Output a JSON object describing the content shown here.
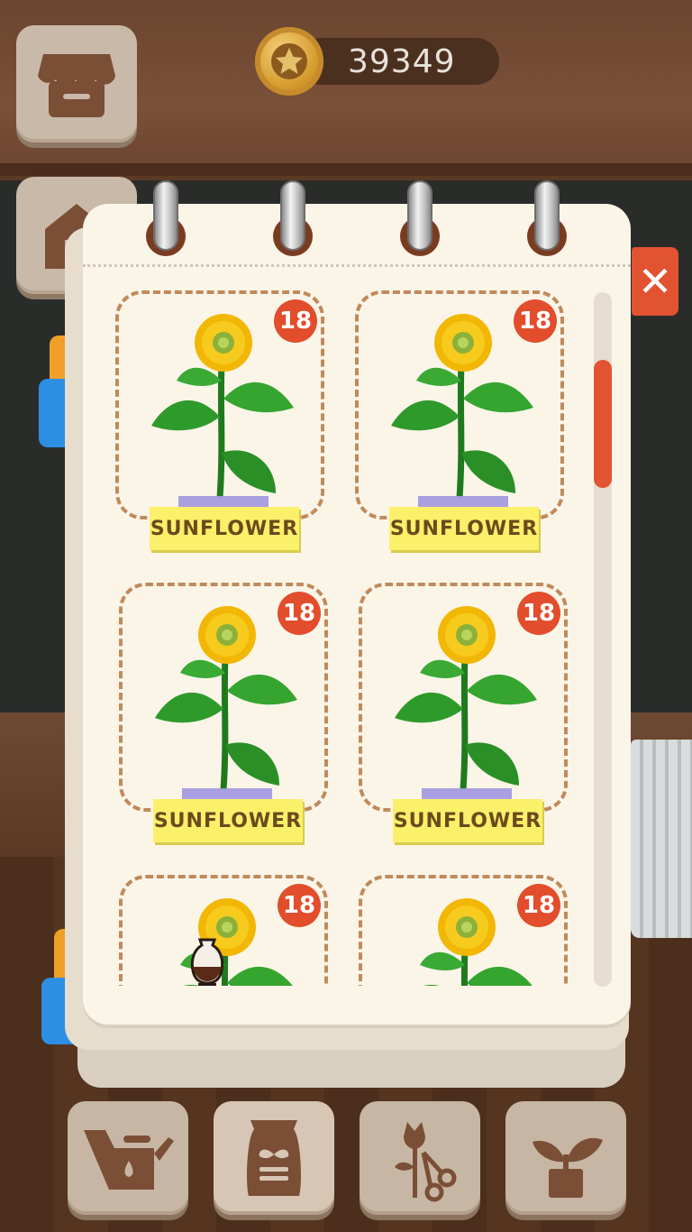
{
  "currency": {
    "coins": "39349",
    "icon": "star-coin-icon"
  },
  "close_label": "✕",
  "colors": {
    "accent_red": "#e25331",
    "label_yellow": "#fbf06a",
    "tape_purple": "#a59ae0",
    "paper": "#fbf5e8",
    "dash_brown": "#c08a5c"
  },
  "collection": {
    "items": [
      {
        "name": "SUNFLOWER",
        "level": "18"
      },
      {
        "name": "SUNFLOWER",
        "level": "18"
      },
      {
        "name": "SUNFLOWER",
        "level": "18"
      },
      {
        "name": "SUNFLOWER",
        "level": "18"
      },
      {
        "level": "18"
      },
      {
        "level": "18"
      }
    ],
    "scroll_position": 0.12
  },
  "toolbar": {
    "buttons": [
      {
        "icon": "watering-can-icon"
      },
      {
        "icon": "seed-bag-icon"
      },
      {
        "icon": "flower-scissors-icon"
      },
      {
        "icon": "sprout-pot-icon"
      }
    ]
  },
  "side_buttons": [
    {
      "icon": "shop-icon"
    },
    {
      "icon": "house-icon"
    }
  ]
}
